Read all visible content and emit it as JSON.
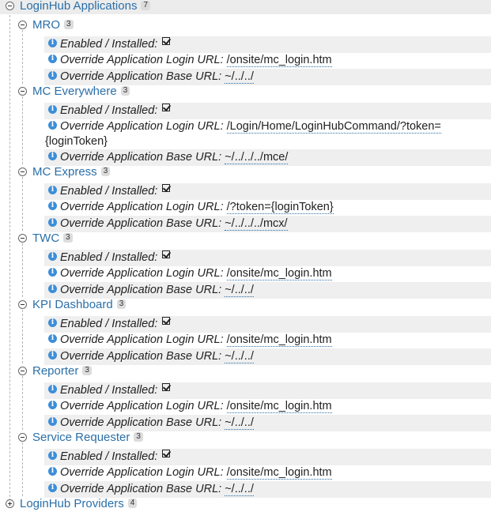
{
  "root": {
    "label": "LoginHub Applications",
    "count": "7"
  },
  "props": {
    "enabled": "Enabled / Installed:",
    "login_url": "Override Application Login URL:",
    "base_url": "Override Application Base URL:"
  },
  "apps": [
    {
      "name": "MRO",
      "count": "3",
      "login_url": "/onsite/mc_login.htm",
      "base_url": "~/../../"
    },
    {
      "name": "MC Everywhere",
      "count": "3",
      "login_url": "/Login/Home/LoginHubCommand/?token=",
      "login_url_cont": "{loginToken}",
      "base_url": "~/../../../mce/"
    },
    {
      "name": "MC Express",
      "count": "3",
      "login_url": "/?token={loginToken}",
      "base_url": "~/../../../mcx/"
    },
    {
      "name": "TWC",
      "count": "3",
      "login_url": "/onsite/mc_login.htm",
      "base_url": "~/../../"
    },
    {
      "name": "KPI Dashboard",
      "count": "3",
      "login_url": "/onsite/mc_login.htm",
      "base_url": "~/../../"
    },
    {
      "name": "Reporter",
      "count": "3",
      "login_url": "/onsite/mc_login.htm",
      "base_url": "~/../../"
    },
    {
      "name": "Service Requester",
      "count": "3",
      "login_url": "/onsite/mc_login.htm",
      "base_url": "~/../../"
    }
  ],
  "providers": {
    "label": "LoginHub Providers",
    "count": "4"
  }
}
